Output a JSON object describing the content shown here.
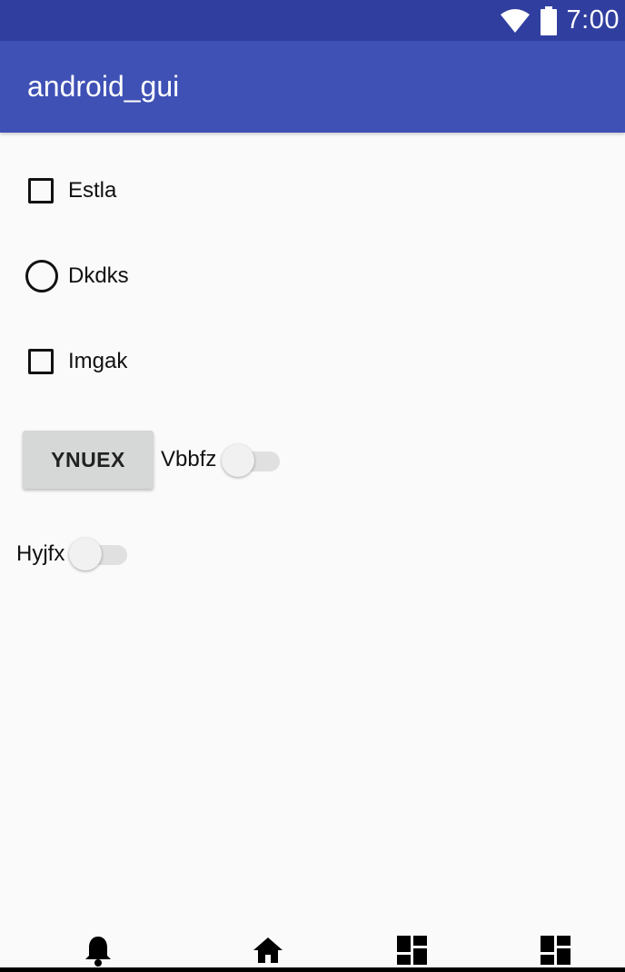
{
  "status_bar": {
    "time": "7:00",
    "icons": [
      "wifi-icon",
      "battery-icon"
    ]
  },
  "app_bar": {
    "title": "android_gui"
  },
  "widgets": {
    "checkbox_1": {
      "label": "Estla",
      "checked": false
    },
    "radio_1": {
      "label": "Dkdks",
      "selected": false
    },
    "checkbox_2": {
      "label": "Imgak",
      "checked": false
    },
    "button_1": {
      "label": "YNUEX"
    },
    "switch_1": {
      "label": "Vbbfz",
      "on": false
    },
    "switch_2": {
      "label": "Hyjfx",
      "on": false
    }
  },
  "bottom_nav": {
    "icons": [
      "bell-icon",
      "home-icon",
      "dashboard-icon",
      "dashboard-icon"
    ]
  },
  "colors": {
    "status_bar": "#303f9f",
    "app_bar": "#3f51b5",
    "background": "#fafafa",
    "button": "#d6d7d7"
  }
}
